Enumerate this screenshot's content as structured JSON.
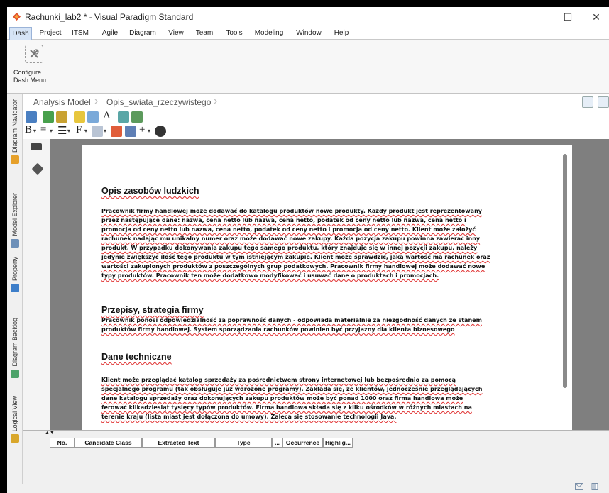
{
  "window": {
    "title": "Rachunki_lab2 * - Visual Paradigm Standard",
    "controls": {
      "minimize": "—",
      "maximize": "☐",
      "close": "✕"
    }
  },
  "menu": {
    "items": [
      "Dash",
      "Project",
      "ITSM",
      "Agile",
      "Diagram",
      "View",
      "Team",
      "Tools",
      "Modeling",
      "Window",
      "Help"
    ],
    "active": "Dash"
  },
  "ribbon": {
    "configure_label_line1": "Configure",
    "configure_label_line2": "Dash Menu"
  },
  "left_tabs": [
    "Diagram Navigator",
    "Model Explorer",
    "Property",
    "Diagram Backlog",
    "Logical View"
  ],
  "breadcrumb": {
    "items": [
      "Analysis Model",
      "Opis_swiata_rzeczywistego"
    ]
  },
  "toolbar": {
    "bold": "B",
    "font": "F",
    "text_style": "A"
  },
  "document": {
    "sections": [
      {
        "heading": "Opis zasobów ludzkich",
        "lines": [
          "Pracownik firmy handlowej może dodawać do katalogu produktów nowe produkty. Każdy produkt jest reprezentowany",
          "przez następujące dane: nazwa, cena netto lub nazwa, cena netto, podatek od ceny netto lub nazwa, cena netto i",
          "promocja od ceny netto lub nazwa, cena netto, podatek od ceny netto i promocja od ceny netto. Klient może założyć",
          "rachunek nadając mu unikalny numer oraz może dodawać nowe zakupy. Każda pozycja zakupu powinna zawierać inny",
          "produkt. W przypadku dokonywania zakupu tego samego produktu, który znajduje się w innej pozycji zakupu, należy",
          "jedynie zwiększyć ilość tego produktu w tym istniejącym zakupie. Klient może sprawdzić, jaką wartość ma rachunek oraz",
          "wartości zakupionych produktów z poszczególnych grup podatkowych. Pracownik firmy handlowej może dodawać nowe",
          "typy produktów. Pracownik ten może dodatkowo modyfikować i usuwać dane o produktach i promocjach."
        ]
      },
      {
        "heading": "Przepisy, strategia firmy",
        "lines": [
          "Pracownik ponosi odpowiedzialność za poprawność danych - odpowiada materialnie za niezgodność danych ze stanem",
          "produktów firmy handlowej. System sporządzania rachunków powinien być przyjazny dla klienta biznesowego"
        ]
      },
      {
        "heading": "Dane techniczne",
        "lines": [
          "Klient może przeglądać katalog sprzedaży za pośrednictwem strony internetowej lub bezpośrednio za pomocą",
          "specjalnego programu (tak obsługuje już wdrożone programy). Zakłada się, że klientów, jednocześnie przeglądających",
          "dane katalogu sprzedaży oraz dokonujących zakupu produktów może być ponad 1000 oraz firma handlowa może",
          "ferować kilkadziesiąt tysięcy typów produktów. Firma handlowa składa się z kilku ośrodków w różnych miastach na",
          "terenie kraju (lista miast jest dołączona do umowy). Zaleca się stosowanie technologii Java."
        ]
      }
    ]
  },
  "table": {
    "columns": [
      "No.",
      "Candidate Class",
      "Extracted Text",
      "Type",
      "...",
      "Occurrence",
      "Highlig..."
    ],
    "sort_arrows": "▲▼"
  },
  "colors": {
    "accent": "#d6e4f6",
    "spellcheck": "#e03030",
    "canvas": "#7f7f7f"
  }
}
